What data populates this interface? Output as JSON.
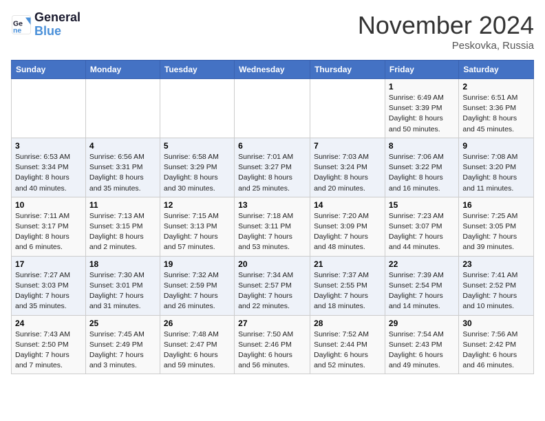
{
  "header": {
    "logo_line1": "General",
    "logo_line2": "Blue",
    "month_title": "November 2024",
    "location": "Peskovka, Russia"
  },
  "days_of_week": [
    "Sunday",
    "Monday",
    "Tuesday",
    "Wednesday",
    "Thursday",
    "Friday",
    "Saturday"
  ],
  "weeks": [
    [
      {
        "day": "",
        "info": ""
      },
      {
        "day": "",
        "info": ""
      },
      {
        "day": "",
        "info": ""
      },
      {
        "day": "",
        "info": ""
      },
      {
        "day": "",
        "info": ""
      },
      {
        "day": "1",
        "info": "Sunrise: 6:49 AM\nSunset: 3:39 PM\nDaylight: 8 hours and 50 minutes."
      },
      {
        "day": "2",
        "info": "Sunrise: 6:51 AM\nSunset: 3:36 PM\nDaylight: 8 hours and 45 minutes."
      }
    ],
    [
      {
        "day": "3",
        "info": "Sunrise: 6:53 AM\nSunset: 3:34 PM\nDaylight: 8 hours and 40 minutes."
      },
      {
        "day": "4",
        "info": "Sunrise: 6:56 AM\nSunset: 3:31 PM\nDaylight: 8 hours and 35 minutes."
      },
      {
        "day": "5",
        "info": "Sunrise: 6:58 AM\nSunset: 3:29 PM\nDaylight: 8 hours and 30 minutes."
      },
      {
        "day": "6",
        "info": "Sunrise: 7:01 AM\nSunset: 3:27 PM\nDaylight: 8 hours and 25 minutes."
      },
      {
        "day": "7",
        "info": "Sunrise: 7:03 AM\nSunset: 3:24 PM\nDaylight: 8 hours and 20 minutes."
      },
      {
        "day": "8",
        "info": "Sunrise: 7:06 AM\nSunset: 3:22 PM\nDaylight: 8 hours and 16 minutes."
      },
      {
        "day": "9",
        "info": "Sunrise: 7:08 AM\nSunset: 3:20 PM\nDaylight: 8 hours and 11 minutes."
      }
    ],
    [
      {
        "day": "10",
        "info": "Sunrise: 7:11 AM\nSunset: 3:17 PM\nDaylight: 8 hours and 6 minutes."
      },
      {
        "day": "11",
        "info": "Sunrise: 7:13 AM\nSunset: 3:15 PM\nDaylight: 8 hours and 2 minutes."
      },
      {
        "day": "12",
        "info": "Sunrise: 7:15 AM\nSunset: 3:13 PM\nDaylight: 7 hours and 57 minutes."
      },
      {
        "day": "13",
        "info": "Sunrise: 7:18 AM\nSunset: 3:11 PM\nDaylight: 7 hours and 53 minutes."
      },
      {
        "day": "14",
        "info": "Sunrise: 7:20 AM\nSunset: 3:09 PM\nDaylight: 7 hours and 48 minutes."
      },
      {
        "day": "15",
        "info": "Sunrise: 7:23 AM\nSunset: 3:07 PM\nDaylight: 7 hours and 44 minutes."
      },
      {
        "day": "16",
        "info": "Sunrise: 7:25 AM\nSunset: 3:05 PM\nDaylight: 7 hours and 39 minutes."
      }
    ],
    [
      {
        "day": "17",
        "info": "Sunrise: 7:27 AM\nSunset: 3:03 PM\nDaylight: 7 hours and 35 minutes."
      },
      {
        "day": "18",
        "info": "Sunrise: 7:30 AM\nSunset: 3:01 PM\nDaylight: 7 hours and 31 minutes."
      },
      {
        "day": "19",
        "info": "Sunrise: 7:32 AM\nSunset: 2:59 PM\nDaylight: 7 hours and 26 minutes."
      },
      {
        "day": "20",
        "info": "Sunrise: 7:34 AM\nSunset: 2:57 PM\nDaylight: 7 hours and 22 minutes."
      },
      {
        "day": "21",
        "info": "Sunrise: 7:37 AM\nSunset: 2:55 PM\nDaylight: 7 hours and 18 minutes."
      },
      {
        "day": "22",
        "info": "Sunrise: 7:39 AM\nSunset: 2:54 PM\nDaylight: 7 hours and 14 minutes."
      },
      {
        "day": "23",
        "info": "Sunrise: 7:41 AM\nSunset: 2:52 PM\nDaylight: 7 hours and 10 minutes."
      }
    ],
    [
      {
        "day": "24",
        "info": "Sunrise: 7:43 AM\nSunset: 2:50 PM\nDaylight: 7 hours and 7 minutes."
      },
      {
        "day": "25",
        "info": "Sunrise: 7:45 AM\nSunset: 2:49 PM\nDaylight: 7 hours and 3 minutes."
      },
      {
        "day": "26",
        "info": "Sunrise: 7:48 AM\nSunset: 2:47 PM\nDaylight: 6 hours and 59 minutes."
      },
      {
        "day": "27",
        "info": "Sunrise: 7:50 AM\nSunset: 2:46 PM\nDaylight: 6 hours and 56 minutes."
      },
      {
        "day": "28",
        "info": "Sunrise: 7:52 AM\nSunset: 2:44 PM\nDaylight: 6 hours and 52 minutes."
      },
      {
        "day": "29",
        "info": "Sunrise: 7:54 AM\nSunset: 2:43 PM\nDaylight: 6 hours and 49 minutes."
      },
      {
        "day": "30",
        "info": "Sunrise: 7:56 AM\nSunset: 2:42 PM\nDaylight: 6 hours and 46 minutes."
      }
    ]
  ]
}
